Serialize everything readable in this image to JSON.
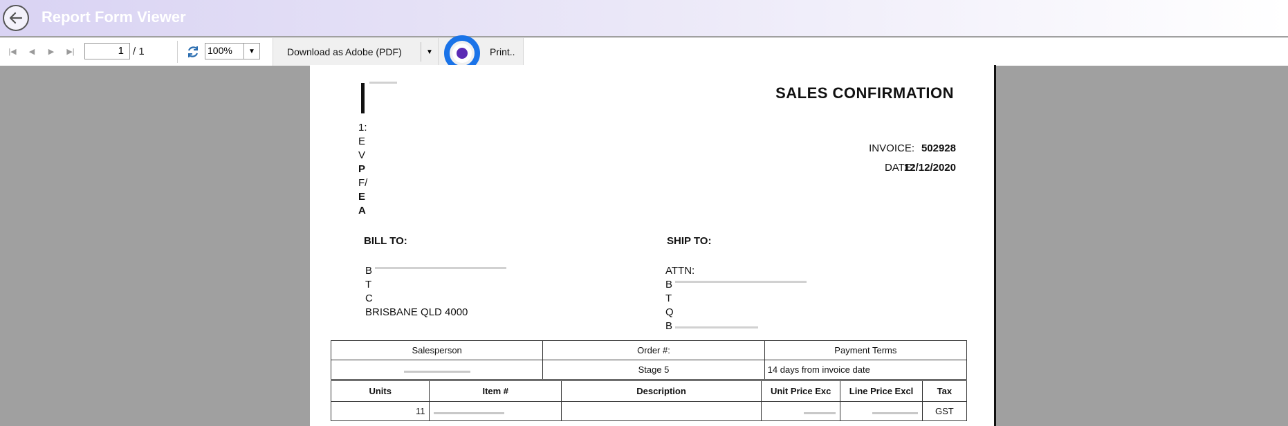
{
  "window": {
    "title": "Report Form Viewer"
  },
  "toolbar": {
    "page_current": "1",
    "page_total": "/ 1",
    "zoom": "100%",
    "download_label": "Download as Adobe (PDF)",
    "print_label": "Print.."
  },
  "report": {
    "heading": "SALES CONFIRMATION",
    "company_letters": [
      "1:",
      "E",
      "V",
      "P",
      "F/",
      "E",
      "A"
    ],
    "invoice_label": "INVOICE:",
    "invoice_value": "502928",
    "date_label": "DATE:",
    "date_value": "12/12/2020",
    "bill_to_label": "BILL TO:",
    "bill_to_lines": [
      "B",
      "T",
      "C",
      "BRISBANE QLD 4000"
    ],
    "ship_to_label": "SHIP TO:",
    "ship_to_lines": [
      "ATTN:",
      "B",
      "T",
      "Q",
      "B"
    ],
    "summary_headers": [
      "Salesperson",
      "Order #:",
      "Payment Terms"
    ],
    "summary_values": [
      "",
      "Stage 5",
      "14 days from invoice date"
    ],
    "item_headers": [
      "Units",
      "Item #",
      "Description",
      "Unit Price Exc",
      "Line Price Excl",
      "Tax"
    ],
    "item_rows": [
      {
        "units": "11",
        "item": "",
        "description": "",
        "unit_price": "",
        "line_price": "",
        "tax": "GST"
      }
    ]
  },
  "colors": {
    "titlebar_start": "#d9d3f3",
    "print_ring": "#1a73e8",
    "print_dot": "#5b2bb5",
    "background": "#a0a0a0"
  }
}
